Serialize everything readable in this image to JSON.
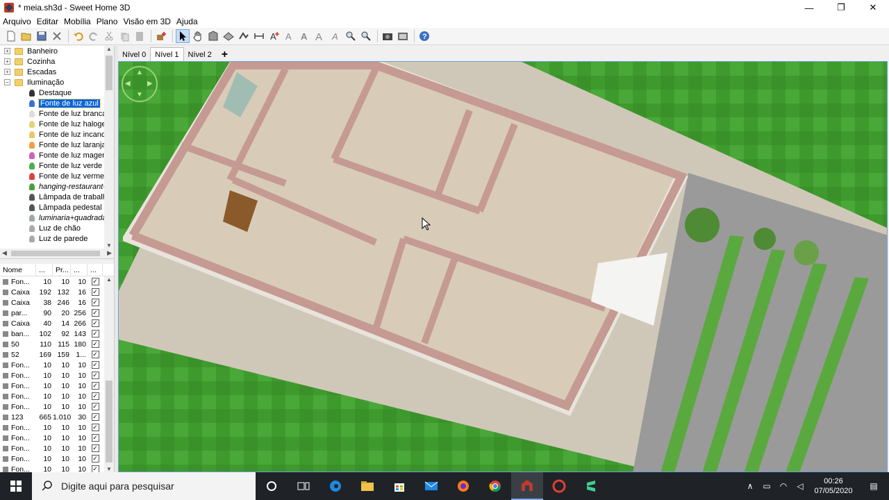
{
  "window": {
    "title": "* meia.sh3d - Sweet Home 3D",
    "minimize": "—",
    "maximize": "❐",
    "close": "✕"
  },
  "menu": [
    "Arquivo",
    "Editar",
    "Mobília",
    "Plano",
    "Visão em 3D",
    "Ajuda"
  ],
  "toolbar_icons": [
    "new-icon",
    "open-icon",
    "save-icon",
    "cut-x-icon",
    "undo-icon",
    "redo-icon",
    "cut-icon",
    "copy-icon",
    "paste-icon",
    "add-furniture-icon",
    "select-arrow-icon",
    "pan-hand-icon",
    "create-walls-icon",
    "create-rooms-icon",
    "create-polylines-icon",
    "create-dimensions-icon",
    "add-text-icon",
    "text-style-icon",
    "bold-icon",
    "italic-icon",
    "zoom-in-icon",
    "zoom-out-icon",
    "create-photo-icon",
    "create-video-icon",
    "help-icon"
  ],
  "catalog": {
    "categories": [
      {
        "label": "Banheiro",
        "expanded": false
      },
      {
        "label": "Cozinha",
        "expanded": false
      },
      {
        "label": "Escadas",
        "expanded": false
      },
      {
        "label": "Iluminação",
        "expanded": true
      }
    ],
    "items": [
      {
        "label": "Destaque",
        "italic": false
      },
      {
        "label": "Fonte de luz azul",
        "italic": false,
        "selected": true
      },
      {
        "label": "Fonte de luz branca",
        "italic": false
      },
      {
        "label": "Fonte de luz halogen",
        "italic": false
      },
      {
        "label": "Fonte de luz incande",
        "italic": false
      },
      {
        "label": "Fonte de luz laranja",
        "italic": false
      },
      {
        "label": "Fonte de luz magent",
        "italic": false
      },
      {
        "label": "Fonte de luz verde",
        "italic": false
      },
      {
        "label": "Fonte de luz vermel",
        "italic": false
      },
      {
        "label": "hanging-restaurant-",
        "italic": true
      },
      {
        "label": "Lâmpada de trabalho",
        "italic": false
      },
      {
        "label": "Lâmpada pedestal",
        "italic": false
      },
      {
        "label": "luminaria+quadrada",
        "italic": true
      },
      {
        "label": "Luz de chão",
        "italic": false
      },
      {
        "label": "Luz de parede",
        "italic": false
      }
    ]
  },
  "furniture_table": {
    "headers": [
      "Nome",
      "...",
      "Pr...",
      "...",
      "..."
    ],
    "rows": [
      {
        "name": "Fon...",
        "w": "10",
        "d": "10",
        "h": "10"
      },
      {
        "name": "Caixa",
        "w": "192",
        "d": "132",
        "h": "16"
      },
      {
        "name": "Caixa",
        "w": "38",
        "d": "246",
        "h": "16"
      },
      {
        "name": "par...",
        "w": "90",
        "d": "20",
        "h": "256"
      },
      {
        "name": "Caixa",
        "w": "40",
        "d": "14",
        "h": "266"
      },
      {
        "name": "ban...",
        "w": "102",
        "d": "92",
        "h": "143"
      },
      {
        "name": "50",
        "w": "110",
        "d": "115",
        "h": "180"
      },
      {
        "name": "52",
        "w": "169",
        "d": "159",
        "h": "1..."
      },
      {
        "name": "Fon...",
        "w": "10",
        "d": "10",
        "h": "10"
      },
      {
        "name": "Fon...",
        "w": "10",
        "d": "10",
        "h": "10"
      },
      {
        "name": "Fon...",
        "w": "10",
        "d": "10",
        "h": "10"
      },
      {
        "name": "Fon...",
        "w": "10",
        "d": "10",
        "h": "10"
      },
      {
        "name": "Fon...",
        "w": "10",
        "d": "10",
        "h": "10"
      },
      {
        "name": "123",
        "w": "665",
        "d": "1.010",
        "h": "30"
      },
      {
        "name": "Fon...",
        "w": "10",
        "d": "10",
        "h": "10"
      },
      {
        "name": "Fon...",
        "w": "10",
        "d": "10",
        "h": "10"
      },
      {
        "name": "Fon...",
        "w": "10",
        "d": "10",
        "h": "10"
      },
      {
        "name": "Fon...",
        "w": "10",
        "d": "10",
        "h": "10"
      },
      {
        "name": "Fon...",
        "w": "10",
        "d": "10",
        "h": "10"
      }
    ]
  },
  "levels": {
    "tabs": [
      "Nível 0",
      "Nível 1",
      "Nível 2"
    ],
    "active": "Nível 1",
    "add": "+"
  },
  "taskbar": {
    "search_placeholder": "Digite aqui para pesquisar",
    "time": "00:26",
    "date": "07/05/2020"
  },
  "colors": {
    "grass": "#3f9a2e",
    "wall": "#c59a92",
    "floor": "#d8ccb8",
    "road": "#9a9a9a",
    "selection": "#0a64d8"
  }
}
